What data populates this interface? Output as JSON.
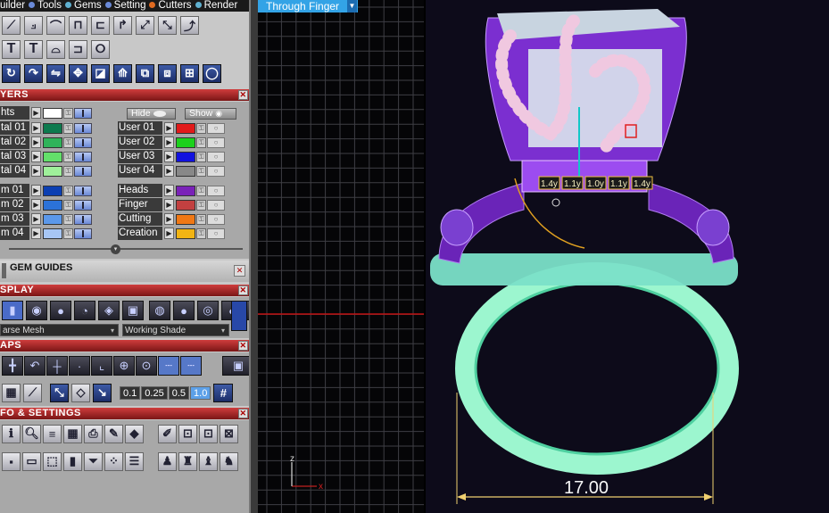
{
  "menu": {
    "items": [
      "uilder",
      "Tools",
      "Gems",
      "Setting",
      "Cutters",
      "Render"
    ]
  },
  "sections": {
    "layers": "YERS",
    "gem_guides": "GEM GUIDES",
    "display": "SPLAY",
    "snaps": "APS",
    "info": "FO & SETTINGS"
  },
  "layers": {
    "lights_label": "hts",
    "hide_label": "Hide",
    "show_label": "Show",
    "left": [
      {
        "name": "tal 01",
        "color": "#0c7a4e"
      },
      {
        "name": "tal 02",
        "color": "#2fb35a"
      },
      {
        "name": "tal 03",
        "color": "#63e06a"
      },
      {
        "name": "tal 04",
        "color": "#9ff09a"
      },
      {
        "name": "m 01",
        "color": "#0c3fb2"
      },
      {
        "name": "m 02",
        "color": "#2b72d8"
      },
      {
        "name": "m 03",
        "color": "#5b98ea"
      },
      {
        "name": "m 04",
        "color": "#a7c6f4"
      }
    ],
    "right": [
      {
        "name": "User 01",
        "color": "#e11a1a"
      },
      {
        "name": "User 02",
        "color": "#1cd11c"
      },
      {
        "name": "User 03",
        "color": "#1212e0"
      },
      {
        "name": "User 04",
        "color": "#888888"
      },
      {
        "name": "Heads",
        "color": "#7a22b8"
      },
      {
        "name": "Finger",
        "color": "#c24040"
      },
      {
        "name": "Cutting",
        "color": "#f07814"
      },
      {
        "name": "Creation",
        "color": "#f2b413"
      }
    ]
  },
  "display": {
    "mesh_mode": "arse Mesh",
    "shade_mode": "Working Shade"
  },
  "snaps": {
    "values": [
      "0.1",
      "0.25",
      "0.5",
      "1.0"
    ],
    "selected": "1.0"
  },
  "viewport": {
    "left_title": "Through Finger",
    "axis_z": "z",
    "axis_x": "x",
    "dimension": "17.00",
    "labels": [
      "1.4y",
      "1.1y",
      "1.0y",
      "1.1y",
      "1.4y"
    ]
  }
}
